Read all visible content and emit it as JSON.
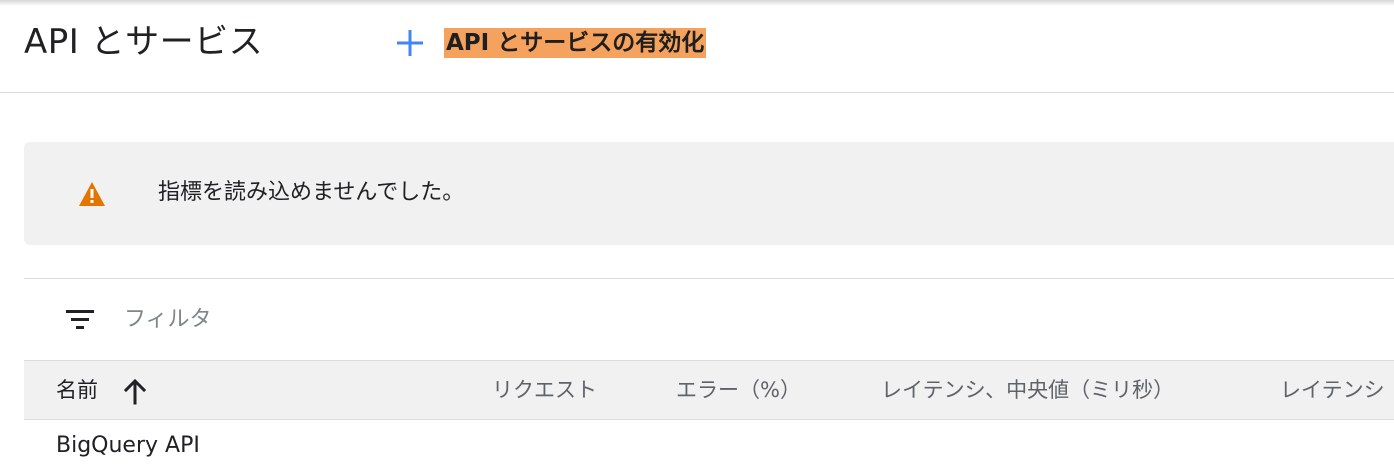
{
  "header": {
    "title": "API とサービス",
    "enable_button_label": "API とサービスの有効化"
  },
  "alert": {
    "message": "指標を読み込めませんでした。"
  },
  "filter": {
    "placeholder": "フィルタ"
  },
  "table": {
    "columns": [
      "名前",
      "リクエスト",
      "エラー（%）",
      "レイテンシ、中央値（ミリ秒）",
      "レイテンシ"
    ],
    "rows": [
      {
        "name": "BigQuery API"
      }
    ]
  },
  "colors": {
    "accent_blue": "#4285f4",
    "warning_orange": "#e37400",
    "highlight": "#f4a25e"
  }
}
